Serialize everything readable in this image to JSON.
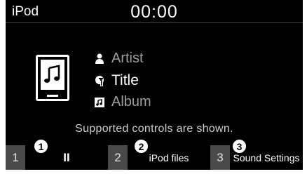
{
  "statusbar": {
    "source": "iPod",
    "time": "00:00"
  },
  "track": {
    "artist": "Artist",
    "title": "Title",
    "album": "Album"
  },
  "message": "Supported controls are shown.",
  "controls": [
    {
      "num": "1",
      "label": "II",
      "callout": "1"
    },
    {
      "num": "2",
      "label": "iPod files",
      "callout": "2"
    },
    {
      "num": "3",
      "label": "Sound Settings",
      "callout": "3"
    }
  ],
  "colors": {
    "background": "#000000",
    "slot_number_bg": "#4a4a4a",
    "dim_text": "#9e9e9e"
  },
  "icons": {
    "artist": "person-icon",
    "title": "title-icon",
    "album": "album-icon",
    "art": "music-note-icon"
  }
}
